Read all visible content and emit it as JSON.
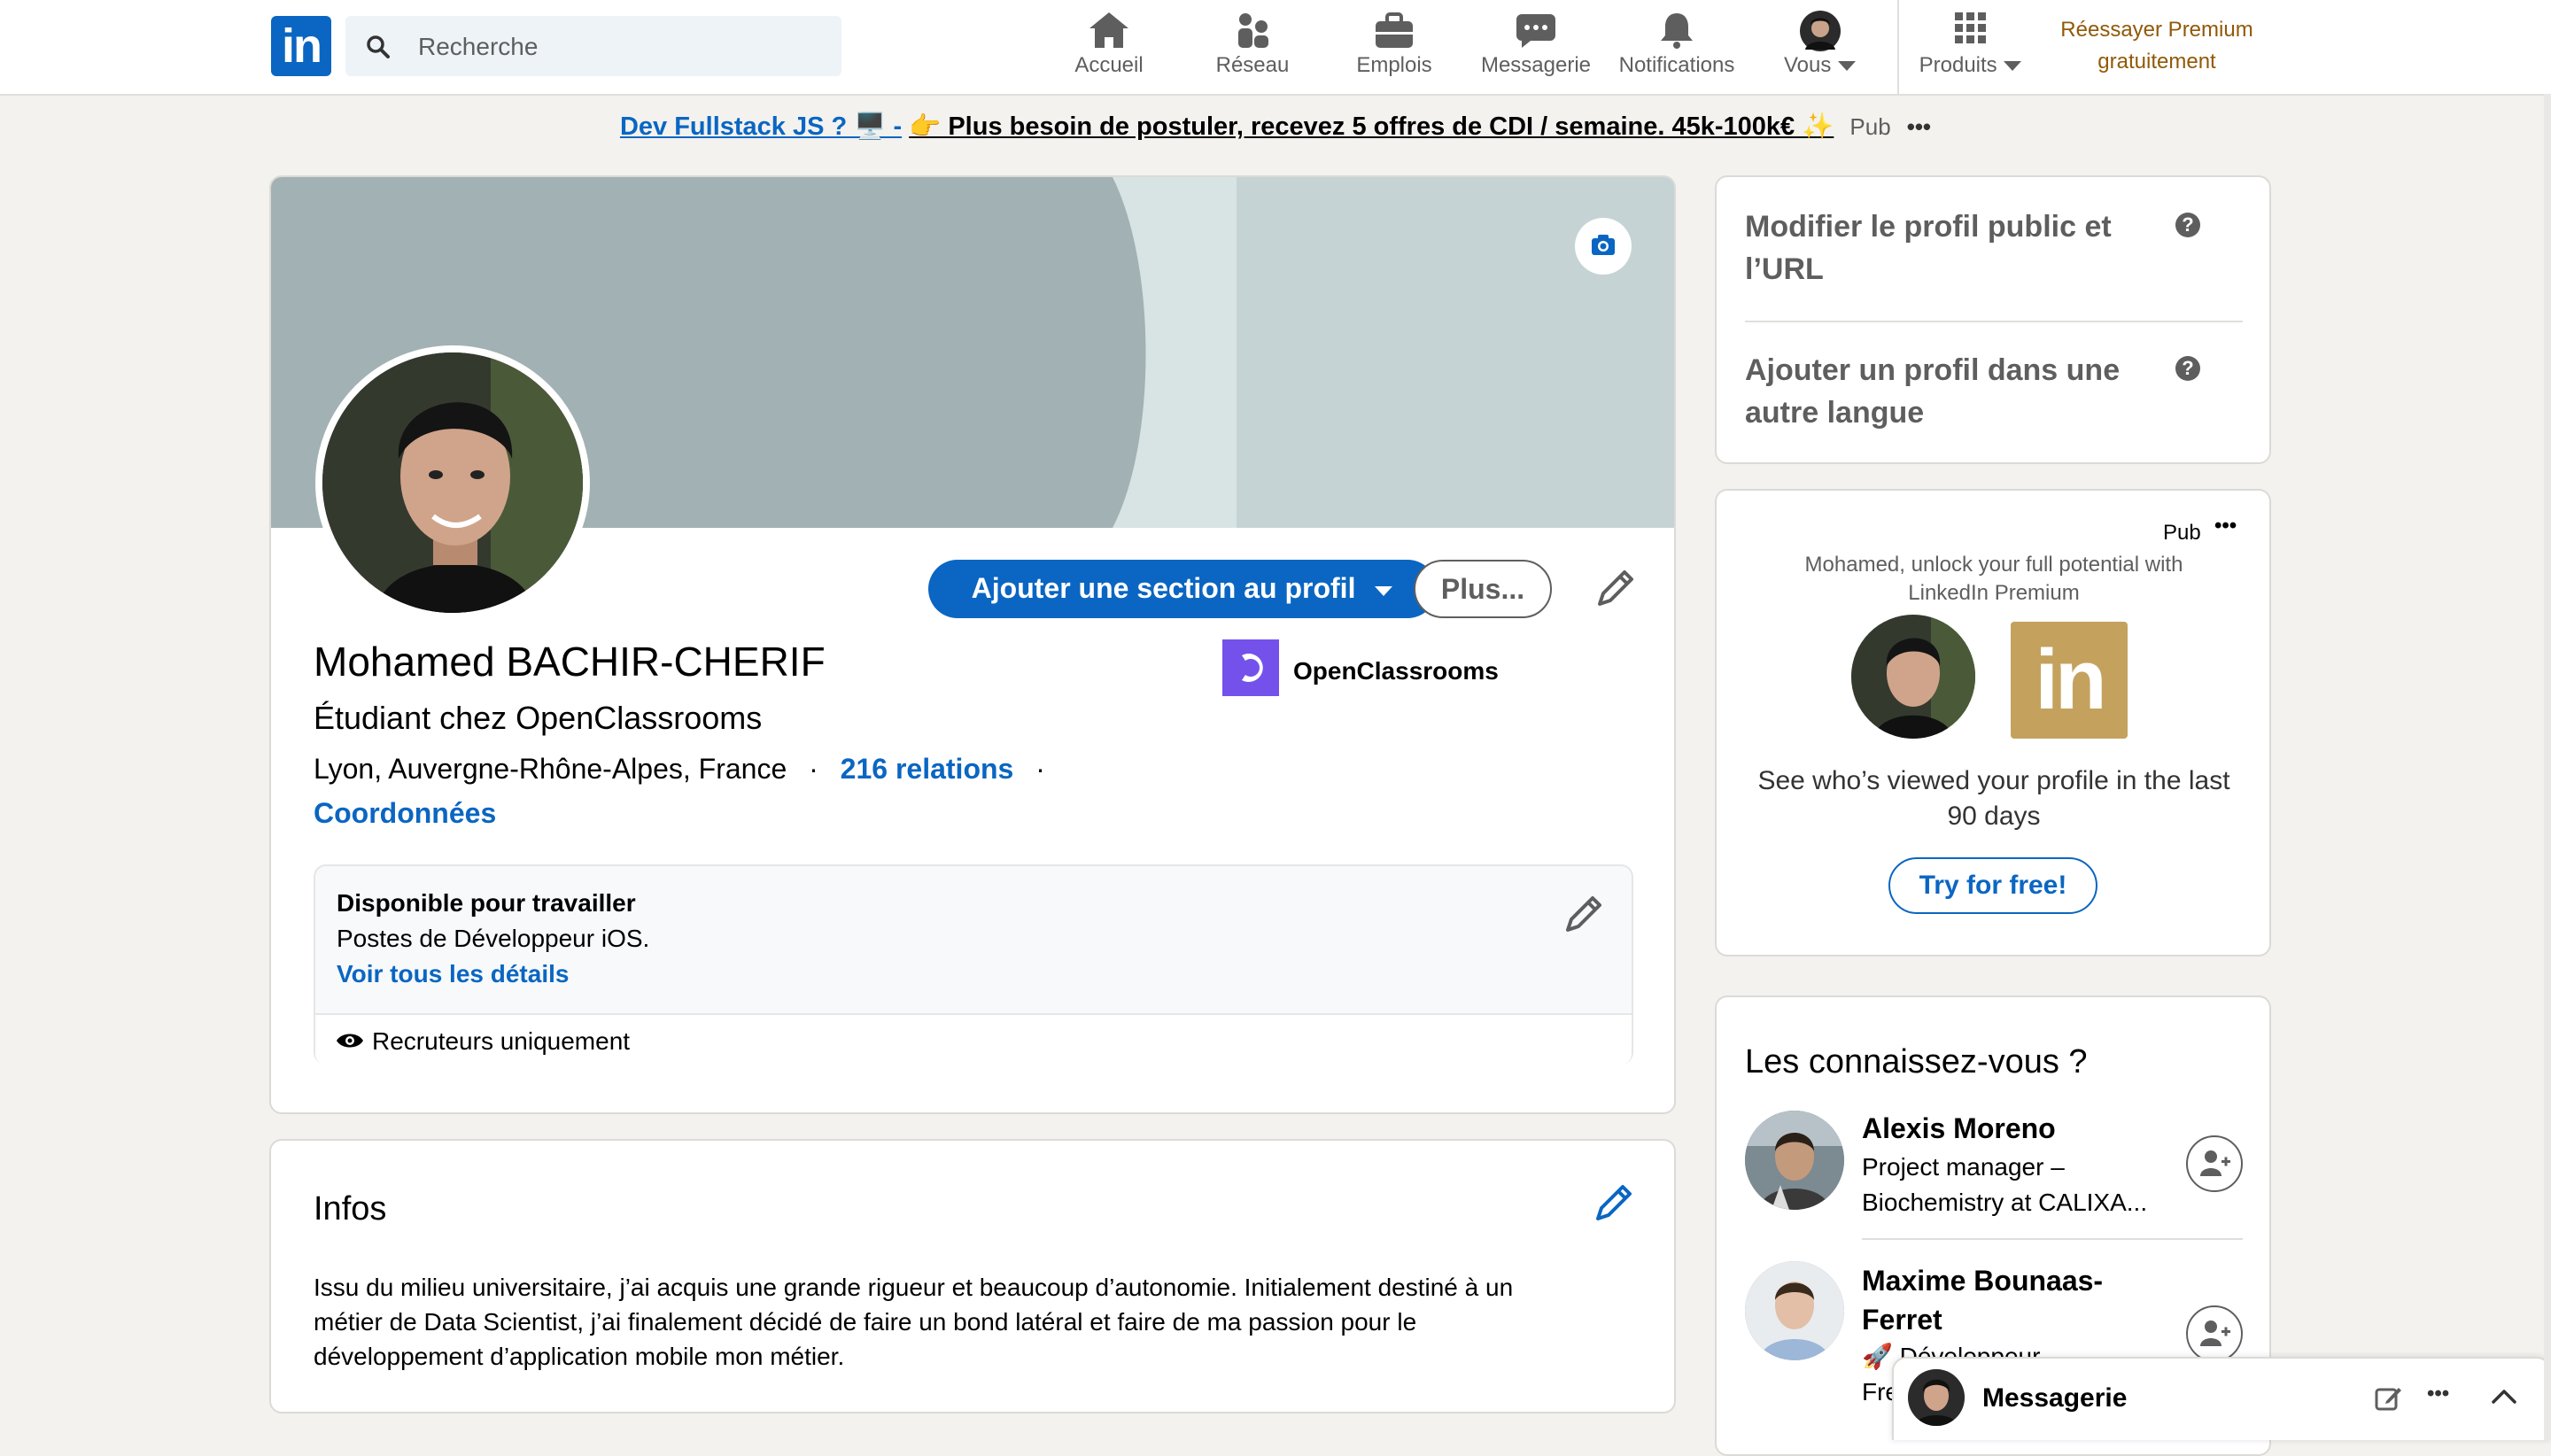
{
  "nav": {
    "search_placeholder": "Recherche",
    "items": [
      {
        "label": "Accueil",
        "icon": "home-icon"
      },
      {
        "label": "Réseau",
        "icon": "network-icon"
      },
      {
        "label": "Emplois",
        "icon": "jobs-icon"
      },
      {
        "label": "Messagerie",
        "icon": "messaging-icon"
      },
      {
        "label": "Notifications",
        "icon": "bell-icon"
      },
      {
        "label": "Vous",
        "icon": "avatar"
      }
    ],
    "products_label": "Produits",
    "premium_line1": "Réessayer Premium",
    "premium_line2": "gratuitement"
  },
  "ad": {
    "link_text": "Dev Fullstack JS ? 🖥️ -",
    "rest_text": "👉 Plus besoin de postuler, recevez 5 offres de CDI / semaine. 45k-100k€ ✨",
    "pub_label": "Pub"
  },
  "profile": {
    "add_section_label": "Ajouter une section au profil",
    "more_label": "Plus...",
    "name": "Mohamed BACHIR-CHERIF",
    "headline": "Étudiant chez OpenClassrooms",
    "location": "Lyon, Auvergne-Rhône-Alpes, France",
    "relations": "216 relations",
    "contact_link": "Coordonnées",
    "company": "OpenClassrooms",
    "open_to_work": {
      "title": "Disponible pour travailler",
      "subtitle": "Postes de Développeur iOS.",
      "details_link": "Voir tous les détails",
      "visibility": "Recruteurs uniquement"
    }
  },
  "about": {
    "title": "Infos",
    "text": "Issu du milieu universitaire, j’ai acquis une grande rigueur et beaucoup d’autonomie. Initialement destiné à un métier de Data Scientist, j’ai finalement décidé de faire un bond latéral et faire de ma passion pour le développement d’application mobile mon métier."
  },
  "side_links": {
    "edit_public_profile": "Modifier le profil public et l’URL",
    "add_language_profile": "Ajouter un profil dans une autre langue"
  },
  "premium_ad": {
    "pub_label": "Pub",
    "tagline": "Mohamed, unlock your full potential with LinkedIn Premium",
    "pitch": "See who’s viewed your profile in the last 90 days",
    "cta": "Try for free!"
  },
  "pymk": {
    "title": "Les connaissez-vous ?",
    "people": [
      {
        "name": "Alexis Moreno",
        "headline": "Project manager – Biochemistry at CALIXA..."
      },
      {
        "name": "Maxime Bounaas-Ferret",
        "headline": "🚀 Développeur Fre..."
      }
    ]
  },
  "messaging": {
    "label": "Messagerie"
  },
  "colors": {
    "brand": "#0a66c2",
    "premium_gold": "#915907",
    "background": "#f3f2ef"
  }
}
